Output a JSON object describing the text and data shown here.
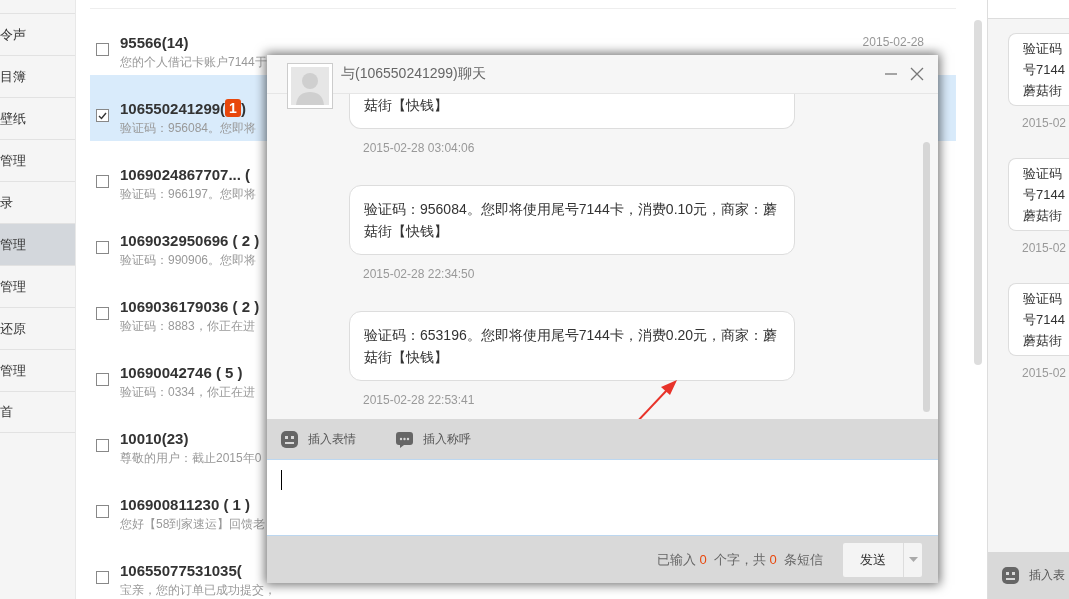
{
  "sidebar": {
    "items": [
      {
        "label": "令声",
        "selected": false
      },
      {
        "label": "目簿",
        "selected": false
      },
      {
        "label": "壁纸",
        "selected": false
      },
      {
        "label": "管理",
        "selected": false
      },
      {
        "label": "录",
        "selected": false
      },
      {
        "label": "管理",
        "selected": true
      },
      {
        "label": "管理",
        "selected": false
      },
      {
        "label": "还原",
        "selected": false
      },
      {
        "label": "管理",
        "selected": false
      },
      {
        "label": "首",
        "selected": false
      }
    ]
  },
  "threads": [
    {
      "title": "95566(14)",
      "preview": "您的个人借记卡账户7144于",
      "date": "2015-02-28",
      "checked": false,
      "selected": false
    },
    {
      "title": "106550241299(",
      "badge": "1",
      "title_end": ")",
      "preview": "验证码：956084。您即将",
      "checked": true,
      "selected": true
    },
    {
      "title": "1069024867707...  (",
      "preview": "验证码：966197。您即将",
      "checked": false,
      "selected": false
    },
    {
      "title": "1069032950696 ( 2 )",
      "preview": "验证码：990906。您即将",
      "checked": false,
      "selected": false
    },
    {
      "title": "1069036179036 ( 2 )",
      "preview": "验证码：8883，你正在进",
      "checked": false,
      "selected": false
    },
    {
      "title": "10690042746 ( 5 )",
      "preview": "验证码：0334，你正在进",
      "checked": false,
      "selected": false
    },
    {
      "title": "10010(23)",
      "preview": "尊敬的用户：截止2015年0",
      "checked": false,
      "selected": false
    },
    {
      "title": "106900811230 ( 1 )",
      "preview": "您好【58到家速运】回馈老",
      "checked": false,
      "selected": false
    },
    {
      "title": "10655077531035(",
      "preview": "宝亲，您的订单已成功提交，",
      "checked": false,
      "selected": false
    }
  ],
  "chat_dialog": {
    "title": "与(106550241299)聊天",
    "messages": [
      {
        "text": "菇街【快钱】",
        "time": "2015-02-28 03:04:06"
      },
      {
        "text": "验证码：956084。您即将使用尾号7144卡，消费0.10元，商家：蘑菇街【快钱】",
        "time": "2015-02-28 22:34:50"
      },
      {
        "text": "验证码：653196。您即将使用尾号7144卡，消费0.20元，商家：蘑菇街【快钱】",
        "time": "2015-02-28 22:53:41"
      }
    ],
    "tools": [
      {
        "kind": "emoji",
        "label": "插入表情"
      },
      {
        "kind": "greeting",
        "label": "插入称呼"
      }
    ],
    "counter": {
      "prefix": "已输入",
      "chars": "0",
      "middle": "个字，共",
      "messages": "0",
      "suffix": "条短信"
    },
    "send_button": "发送"
  },
  "right_panel": {
    "messages": [
      {
        "lines": [
          "验证码",
          "号7144",
          "蘑菇街"
        ],
        "time": "2015-02"
      },
      {
        "lines": [
          "验证码",
          "号7144",
          "蘑菇街"
        ],
        "time": "2015-02"
      },
      {
        "lines": [
          "验证码",
          "号7144",
          "蘑菇街"
        ],
        "time": "2015-02"
      }
    ],
    "tool": "插入表"
  }
}
